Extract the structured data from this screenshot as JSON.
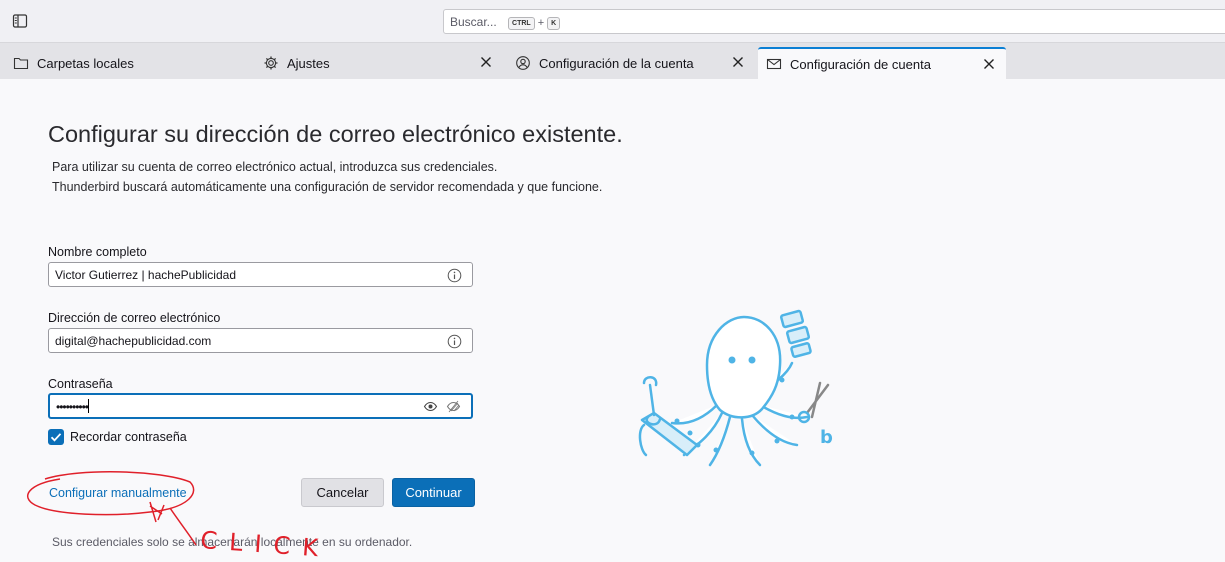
{
  "toolbar": {
    "search_placeholder": "Buscar...",
    "shortcut_key1": "CTRL",
    "shortcut_plus": "+",
    "shortcut_key2": "K"
  },
  "tabs": [
    {
      "label": "Carpetas locales",
      "icon": "folder-icon",
      "closable": false
    },
    {
      "label": "Ajustes",
      "icon": "gear-icon",
      "closable": true
    },
    {
      "label": "Configuración de la cuenta",
      "icon": "account-settings-icon",
      "closable": true
    },
    {
      "label": "Configuración de cuenta",
      "icon": "mail-icon",
      "closable": true,
      "active": true
    }
  ],
  "setup": {
    "heading": "Configurar su dirección de correo electrónico existente.",
    "intro_line1": "Para utilizar su cuenta de correo electrónico actual, introduzca sus credenciales.",
    "intro_line2": "Thunderbird buscará automáticamente una configuración de servidor recomendada y que funcione.",
    "name_label": "Nombre completo",
    "name_value": "Victor Gutierrez | hachePublicidad",
    "email_label": "Dirección de correo electrónico",
    "email_value": "digital@hachepublicidad.com",
    "password_label": "Contraseña",
    "password_value": "••••••••••",
    "remember_label": "Recordar contraseña",
    "remember_checked": true,
    "manual_link": "Configurar manualmente",
    "cancel_button": "Cancelar",
    "continue_button": "Continuar",
    "footnote": "Sus credenciales solo se almacenarán localmente en su ordenador."
  },
  "annotation": {
    "text": "CLICK",
    "color": "#e0202a"
  },
  "colors": {
    "accent": "#0b6fb8",
    "tab_highlight": "#0b7fd4",
    "mascot": "#4fb4e6"
  }
}
